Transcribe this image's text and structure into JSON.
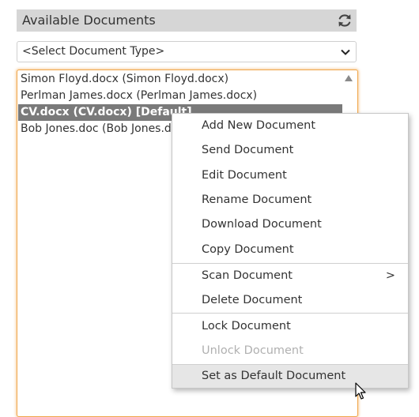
{
  "panel": {
    "title": "Available Documents",
    "refresh_icon": "refresh-icon"
  },
  "document_type_select": {
    "value": "<Select Document Type>",
    "icon": "chevron-down-icon"
  },
  "documents": [
    {
      "label": "Simon Floyd.docx (Simon Floyd.docx)",
      "selected": false
    },
    {
      "label": "Perlman James.docx (Perlman James.docx)",
      "selected": false
    },
    {
      "label": "CV.docx (CV.docx) [Default]",
      "selected": true
    },
    {
      "label": "Bob Jones.doc (Bob Jones.doc)",
      "selected": false
    }
  ],
  "context_menu": {
    "items": [
      {
        "label": "Add New Document",
        "enabled": true
      },
      {
        "label": "Send Document",
        "enabled": true
      },
      {
        "label": "Edit Document",
        "enabled": true
      },
      {
        "label": "Rename Document",
        "enabled": true
      },
      {
        "label": "Download Document",
        "enabled": true
      },
      {
        "label": "Copy Document",
        "enabled": true
      },
      {
        "label": "Scan Document",
        "enabled": true,
        "submenu_indicator": ">"
      },
      {
        "label": "Delete Document",
        "enabled": true
      },
      {
        "label": "Lock Document",
        "enabled": true
      },
      {
        "label": "Unlock Document",
        "enabled": false
      },
      {
        "label": "Set as Default Document",
        "enabled": true,
        "hovered": true
      }
    ]
  },
  "colors": {
    "header_bg": "#d6d6d6",
    "selected_row_bg": "#7a7a7a",
    "focus_border": "#f0a64b",
    "disabled_text": "#b0b0b0",
    "hover_bg": "#e6e6e6"
  },
  "icons": {
    "scroll_up": "triangle-up-icon",
    "cursor": "mouse-pointer-icon"
  }
}
